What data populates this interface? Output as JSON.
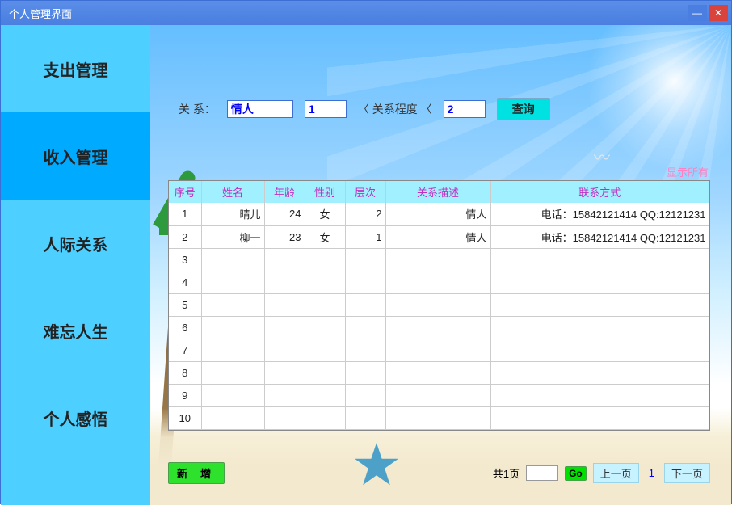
{
  "window": {
    "title": "个人管理界面"
  },
  "sidebar": {
    "items": [
      {
        "label": "支出管理"
      },
      {
        "label": "收入管理"
      },
      {
        "label": "人际关系"
      },
      {
        "label": "难忘人生"
      },
      {
        "label": "个人感悟"
      }
    ],
    "active_index": 1
  },
  "search": {
    "relation_label": "关 系：",
    "relation_value": "情人",
    "from_value": "1",
    "range_label": "〈 关系程度 〈",
    "to_value": "2",
    "query_btn": "查询"
  },
  "show_all": "显示所有",
  "table": {
    "headers": [
      "序号",
      "姓名",
      "年龄",
      "性别",
      "层次",
      "关系描述",
      "联系方式"
    ],
    "rows": [
      {
        "idx": "1",
        "name": "晴儿",
        "age": "24",
        "sex": "女",
        "level": "2",
        "desc": "情人",
        "contact": "电话：15842121414 QQ:12121231"
      },
      {
        "idx": "2",
        "name": "柳一",
        "age": "23",
        "sex": "女",
        "level": "1",
        "desc": "情人",
        "contact": "电话：15842121414 QQ:12121231"
      },
      {
        "idx": "3",
        "name": "",
        "age": "",
        "sex": "",
        "level": "",
        "desc": "",
        "contact": ""
      },
      {
        "idx": "4",
        "name": "",
        "age": "",
        "sex": "",
        "level": "",
        "desc": "",
        "contact": ""
      },
      {
        "idx": "5",
        "name": "",
        "age": "",
        "sex": "",
        "level": "",
        "desc": "",
        "contact": ""
      },
      {
        "idx": "6",
        "name": "",
        "age": "",
        "sex": "",
        "level": "",
        "desc": "",
        "contact": ""
      },
      {
        "idx": "7",
        "name": "",
        "age": "",
        "sex": "",
        "level": "",
        "desc": "",
        "contact": ""
      },
      {
        "idx": "8",
        "name": "",
        "age": "",
        "sex": "",
        "level": "",
        "desc": "",
        "contact": ""
      },
      {
        "idx": "9",
        "name": "",
        "age": "",
        "sex": "",
        "level": "",
        "desc": "",
        "contact": ""
      },
      {
        "idx": "10",
        "name": "",
        "age": "",
        "sex": "",
        "level": "",
        "desc": "",
        "contact": ""
      }
    ]
  },
  "pager": {
    "add_btn": "新 增",
    "total_pages_label": "共1页",
    "go_value": "",
    "go_btn": "Go",
    "prev_btn": "上一页",
    "current_page": "1",
    "next_btn": "下一页"
  }
}
